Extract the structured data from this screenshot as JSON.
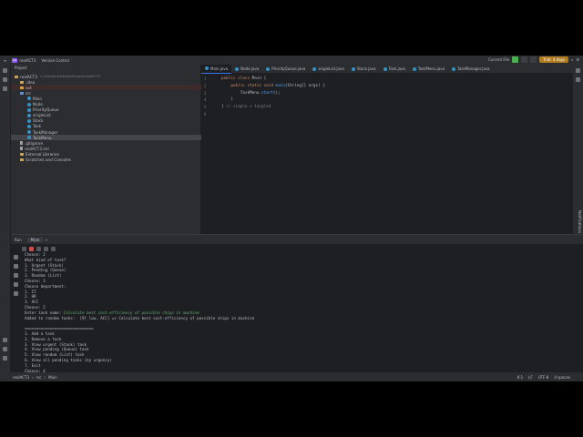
{
  "titlebar": {
    "project_badge": "RA",
    "project_name": "realACT3",
    "vcs": "Version Control",
    "run_config": "Current File",
    "trial": "Trial: 4 days"
  },
  "project_panel": {
    "title": "Project",
    "tree": [
      {
        "label": "realACT3",
        "path": "C:\\Users\\mstelle\\IdeaProjects\\realACT3",
        "type": "root"
      },
      {
        "label": ".idea",
        "type": "folder"
      },
      {
        "label": "out",
        "type": "folder-excluded"
      },
      {
        "label": "src",
        "type": "folder-src"
      },
      {
        "label": "Main",
        "type": "class"
      },
      {
        "label": "Node",
        "type": "class"
      },
      {
        "label": "PriorityQueue",
        "type": "class"
      },
      {
        "label": "singleList",
        "type": "class"
      },
      {
        "label": "Stack",
        "type": "class"
      },
      {
        "label": "Task",
        "type": "class"
      },
      {
        "label": "TaskManager",
        "type": "class"
      },
      {
        "label": "TaskMenu",
        "type": "class",
        "selected": true
      },
      {
        "label": ".gitignore",
        "type": "file"
      },
      {
        "label": "realACT3.iml",
        "type": "file"
      },
      {
        "label": "External Libraries",
        "type": "folder"
      },
      {
        "label": "Scratches and Consoles",
        "type": "folder"
      }
    ]
  },
  "editor": {
    "tabs": [
      "Main.java",
      "Node.java",
      "PriorityQueue.java",
      "singleList.java",
      "Stack.java",
      "Task.java",
      "TaskMenu.java",
      "TaskManager.java"
    ],
    "active_tab": "Main.java",
    "lines": [
      {
        "n": "1",
        "parts": [
          [
            "kw",
            "public class "
          ],
          [
            "tx",
            "Main {"
          ]
        ]
      },
      {
        "n": "2",
        "parts": [
          [
            "kw",
            "    public static void "
          ],
          [
            "fn",
            "main"
          ],
          [
            "tx",
            "(String[] args) {"
          ]
        ]
      },
      {
        "n": "3",
        "parts": [
          [
            "tx",
            "        TaskMenu."
          ],
          [
            "fn",
            "start"
          ],
          [
            "tx",
            "();"
          ]
        ]
      },
      {
        "n": "4",
        "parts": [
          [
            "tx",
            "    }"
          ]
        ]
      },
      {
        "n": "5",
        "parts": [
          [
            "tx",
            "} "
          ],
          [
            "cm",
            "// simple > tangled"
          ]
        ]
      },
      {
        "n": "6",
        "parts": [
          [
            "tx",
            ""
          ]
        ]
      }
    ]
  },
  "run": {
    "tab_run": "Run",
    "tab_config": "Main",
    "console": [
      {
        "t": "Choose: 2"
      },
      {
        "t": "What kind of task?"
      },
      {
        "t": "1. Urgent (Stack)"
      },
      {
        "t": "2. Pending (Queue)"
      },
      {
        "t": "3. Random (List)"
      },
      {
        "t": "Choose: 3"
      },
      {
        "t": "Choose department:"
      },
      {
        "t": "1. IT"
      },
      {
        "t": "2. HR"
      },
      {
        "t": "3. ACC"
      },
      {
        "t": "Choose: 2"
      },
      {
        "t": "Enter task name: ",
        "g": "Calculate best cost-efficiency of possible chips in machine"
      },
      {
        "t": "Added to random tasks:  [9] low, ACC] => Calculate best cost-efficiency of possible chips in machine"
      },
      {
        "t": ""
      },
      {
        "t": "=============================="
      },
      {
        "t": "1. Add a task"
      },
      {
        "t": "2. Remove a task"
      },
      {
        "t": "3. View urgent (Stack) task"
      },
      {
        "t": "4. View pending (Queue) task"
      },
      {
        "t": "5. View random (List) task"
      },
      {
        "t": "6. View all pending tasks (by urgency)"
      },
      {
        "t": "7. Exit"
      },
      {
        "t": "Choose: 4"
      }
    ]
  },
  "statusbar": {
    "path": [
      "realACT3",
      "src",
      "Main"
    ],
    "position": "6:1",
    "line_sep": "LF",
    "encoding": "UTF-8",
    "indent": "4 spaces"
  },
  "right_tool": "Notifications"
}
